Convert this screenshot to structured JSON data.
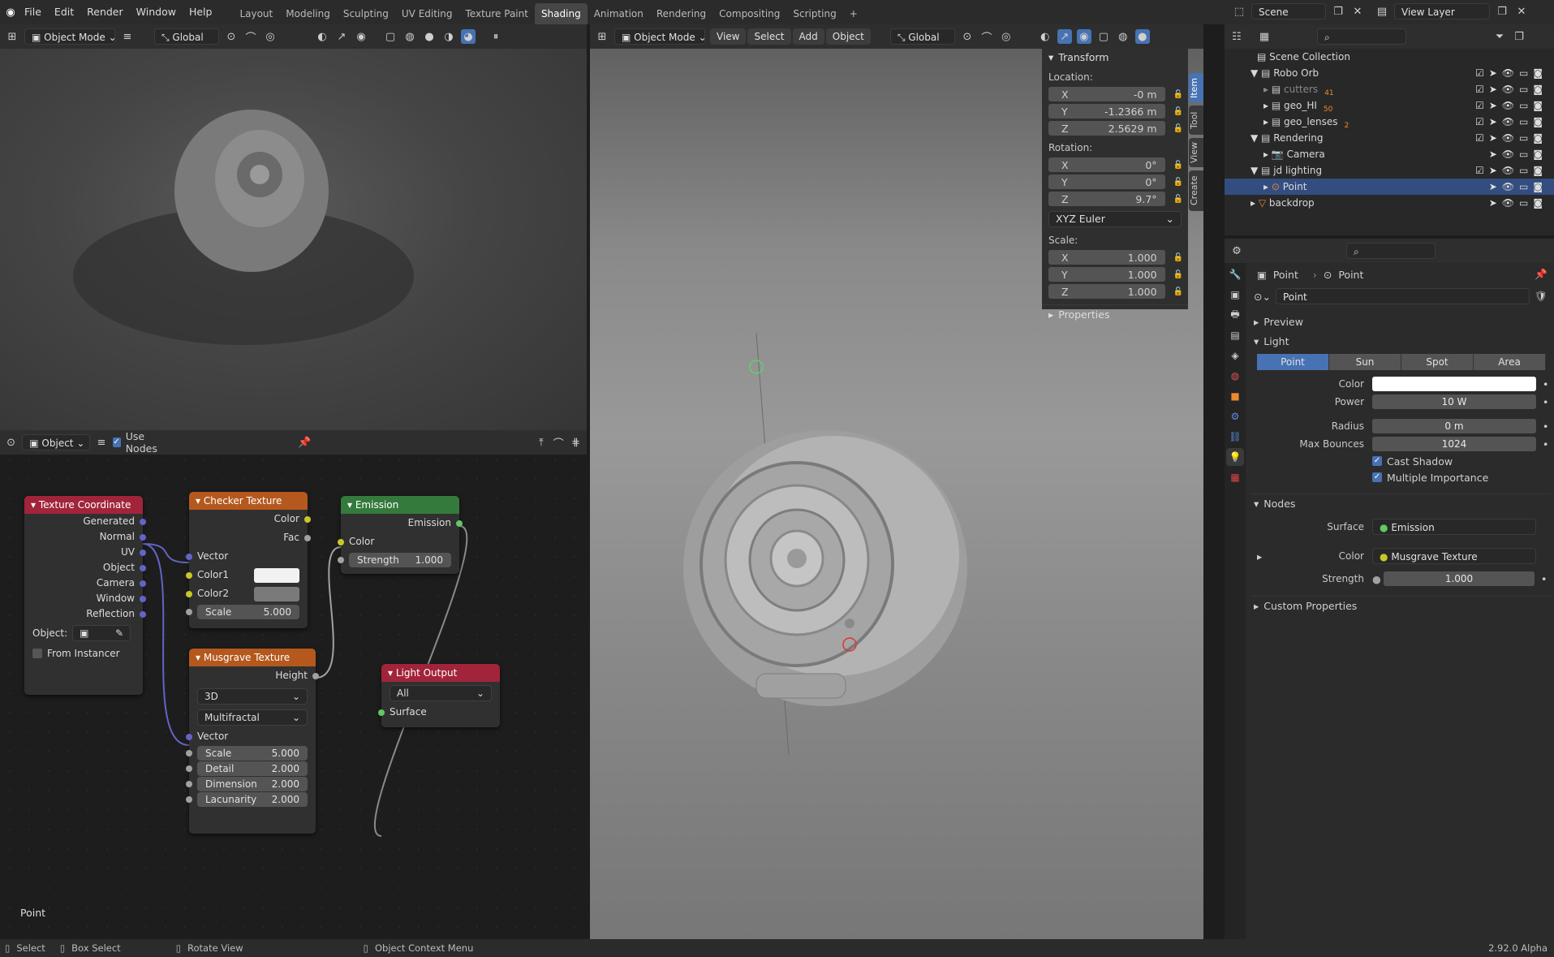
{
  "menu": {
    "items": [
      "File",
      "Edit",
      "Render",
      "Window",
      "Help"
    ]
  },
  "workspaces": {
    "tabs": [
      "Layout",
      "Modeling",
      "Sculpting",
      "UV Editing",
      "Texture Paint",
      "Shading",
      "Animation",
      "Rendering",
      "Compositing",
      "Scripting"
    ],
    "active": "Shading",
    "add": "+"
  },
  "topright": {
    "scene": "Scene",
    "view_layer": "View Layer"
  },
  "leftviewport": {
    "mode": "Object Mode",
    "orientation": "Global"
  },
  "nodeeditor": {
    "type": "Object",
    "use_nodes": "Use Nodes",
    "footer_label": "Point",
    "texcoord": {
      "title": "Texture Coordinate",
      "outputs": [
        "Generated",
        "Normal",
        "UV",
        "Object",
        "Camera",
        "Window",
        "Reflection"
      ],
      "object_label": "Object:",
      "from_instancer": "From Instancer"
    },
    "checker": {
      "title": "Checker Texture",
      "outputs": [
        "Color",
        "Fac"
      ],
      "vector": "Vector",
      "color1": "Color1",
      "color2": "Color2",
      "scale_label": "Scale",
      "scale": "5.000"
    },
    "emission": {
      "title": "Emission",
      "output": "Emission",
      "color": "Color",
      "strength_label": "Strength",
      "strength": "1.000"
    },
    "musgrave": {
      "title": "Musgrave Texture",
      "output": "Height",
      "dim": "3D",
      "type": "Multifractal",
      "vector": "Vector",
      "fields": [
        [
          "Scale",
          "5.000"
        ],
        [
          "Detail",
          "2.000"
        ],
        [
          "Dimension",
          "2.000"
        ],
        [
          "Lacunarity",
          "2.000"
        ]
      ]
    },
    "lightout": {
      "title": "Light Output",
      "target": "All",
      "surface": "Surface"
    }
  },
  "viewport": {
    "mode": "Object Mode",
    "menus": [
      "View",
      "Select",
      "Add",
      "Object"
    ],
    "orientation": "Global"
  },
  "npanel": {
    "tabs": [
      "Item",
      "Tool",
      "View",
      "Create"
    ],
    "transform": "Transform",
    "location": "Location:",
    "loc": [
      [
        "X",
        "-0 m"
      ],
      [
        "Y",
        "-1.2366 m"
      ],
      [
        "Z",
        "2.5629 m"
      ]
    ],
    "rotation": "Rotation:",
    "rot": [
      [
        "X",
        "0°"
      ],
      [
        "Y",
        "0°"
      ],
      [
        "Z",
        "9.7°"
      ]
    ],
    "rotmode": "XYZ Euler",
    "scale": "Scale:",
    "scl": [
      [
        "X",
        "1.000"
      ],
      [
        "Y",
        "1.000"
      ],
      [
        "Z",
        "1.000"
      ]
    ],
    "properties": "Properties"
  },
  "outliner": {
    "root": "Scene Collection",
    "rows": [
      {
        "label": "Robo Orb",
        "indent": 1,
        "kind": "collection",
        "open": "▼"
      },
      {
        "label": "cutters",
        "indent": 2,
        "kind": "collection",
        "open": "▸",
        "badge": "41",
        "dim": true
      },
      {
        "label": "geo_HI",
        "indent": 2,
        "kind": "collection",
        "open": "▸",
        "badge": "50"
      },
      {
        "label": "geo_lenses",
        "indent": 2,
        "kind": "collection",
        "open": "▸",
        "badge": "2"
      },
      {
        "label": "Rendering",
        "indent": 1,
        "kind": "collection",
        "open": "▼"
      },
      {
        "label": "Camera",
        "indent": 2,
        "kind": "camera",
        "open": "▸"
      },
      {
        "label": "jd lighting",
        "indent": 1,
        "kind": "collection",
        "open": "▼"
      },
      {
        "label": "Point",
        "indent": 2,
        "kind": "light",
        "open": "▸",
        "selected": true
      },
      {
        "label": "backdrop",
        "indent": 1,
        "kind": "mesh",
        "open": "▸"
      }
    ]
  },
  "properties": {
    "breadcrumb_obj": "Point",
    "breadcrumb_data": "Point",
    "datablock": "Point",
    "preview": "Preview",
    "light": "Light",
    "light_types": [
      "Point",
      "Sun",
      "Spot",
      "Area"
    ],
    "active_type": "Point",
    "fields": {
      "color_label": "Color",
      "power_label": "Power",
      "power": "10 W",
      "radius_label": "Radius",
      "radius": "0 m",
      "bounces_label": "Max Bounces",
      "bounces": "1024",
      "cast_shadow": "Cast Shadow",
      "mis": "Multiple Importance"
    },
    "nodes": "Nodes",
    "surface_label": "Surface",
    "surface": "Emission",
    "color_label": "Color",
    "color_link": "Musgrave Texture",
    "strength_label": "Strength",
    "strength": "1.000",
    "custom": "Custom Properties"
  },
  "status": {
    "select": "Select",
    "box": "Box Select",
    "rotate": "Rotate View",
    "context": "Object Context Menu",
    "version": "2.92.0 Alpha"
  },
  "colors": {
    "accent": "#4772b3",
    "texcoord": "#a1243a",
    "checker": "#b5581d",
    "emission": "#347a3c",
    "musgrave": "#b5581d",
    "lightout": "#a1243a"
  }
}
